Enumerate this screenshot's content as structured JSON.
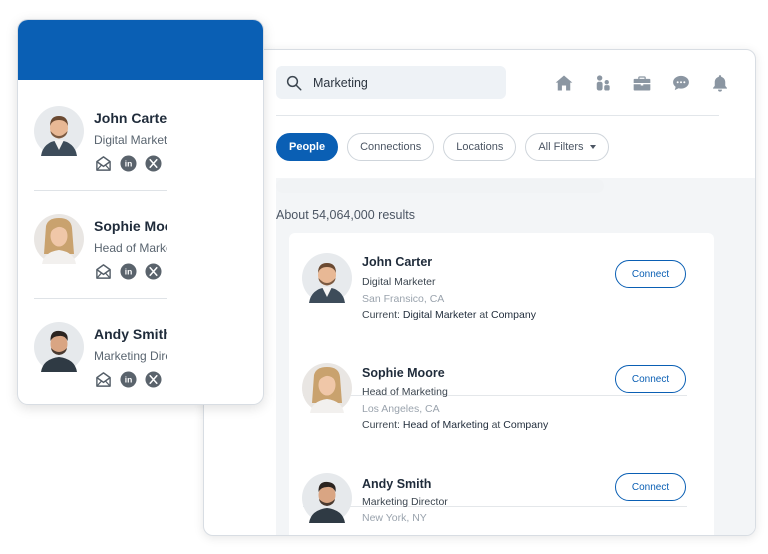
{
  "search": {
    "value": "Marketing"
  },
  "nav": {
    "icons": [
      "home-icon",
      "people-icon",
      "briefcase-icon",
      "messages-icon",
      "bell-icon"
    ]
  },
  "filters": [
    {
      "label": "People",
      "active": true
    },
    {
      "label": "Connections",
      "active": false
    },
    {
      "label": "Locations",
      "active": false
    },
    {
      "label": "All Filters",
      "active": false,
      "dropdown": true
    }
  ],
  "results": {
    "count_text": "About 54,064,000 results",
    "current_prefix": "Current:",
    "at_word": "at",
    "items": [
      {
        "name": "John Carter",
        "title": "Digital Marketer",
        "location": "San Fransico, CA",
        "current_role": "Digital Marketer",
        "company": "Company",
        "action": "Connect"
      },
      {
        "name": "Sophie Moore",
        "title": "Head of Marketing",
        "location": "Los Angeles, CA",
        "current_role": "Head of Marketing",
        "company": "Company",
        "action": "Connect"
      },
      {
        "name": "Andy Smith",
        "title": "Marketing Director",
        "location": "New York, NY",
        "action": "Connect"
      }
    ]
  },
  "side_panel": {
    "contacts": [
      {
        "name": "John Carter",
        "title": "Digital Marketer"
      },
      {
        "name": "Sophie Moore",
        "title": "Head of Marketing"
      },
      {
        "name": "Andy Smith",
        "title": "Marketing Director"
      }
    ],
    "contact_icons": [
      "email-icon",
      "linkedin-icon",
      "x-icon"
    ]
  },
  "colors": {
    "brand": "#0a5fb4",
    "text_dark": "#1f2b3a",
    "muted": "#9aa3ad"
  }
}
